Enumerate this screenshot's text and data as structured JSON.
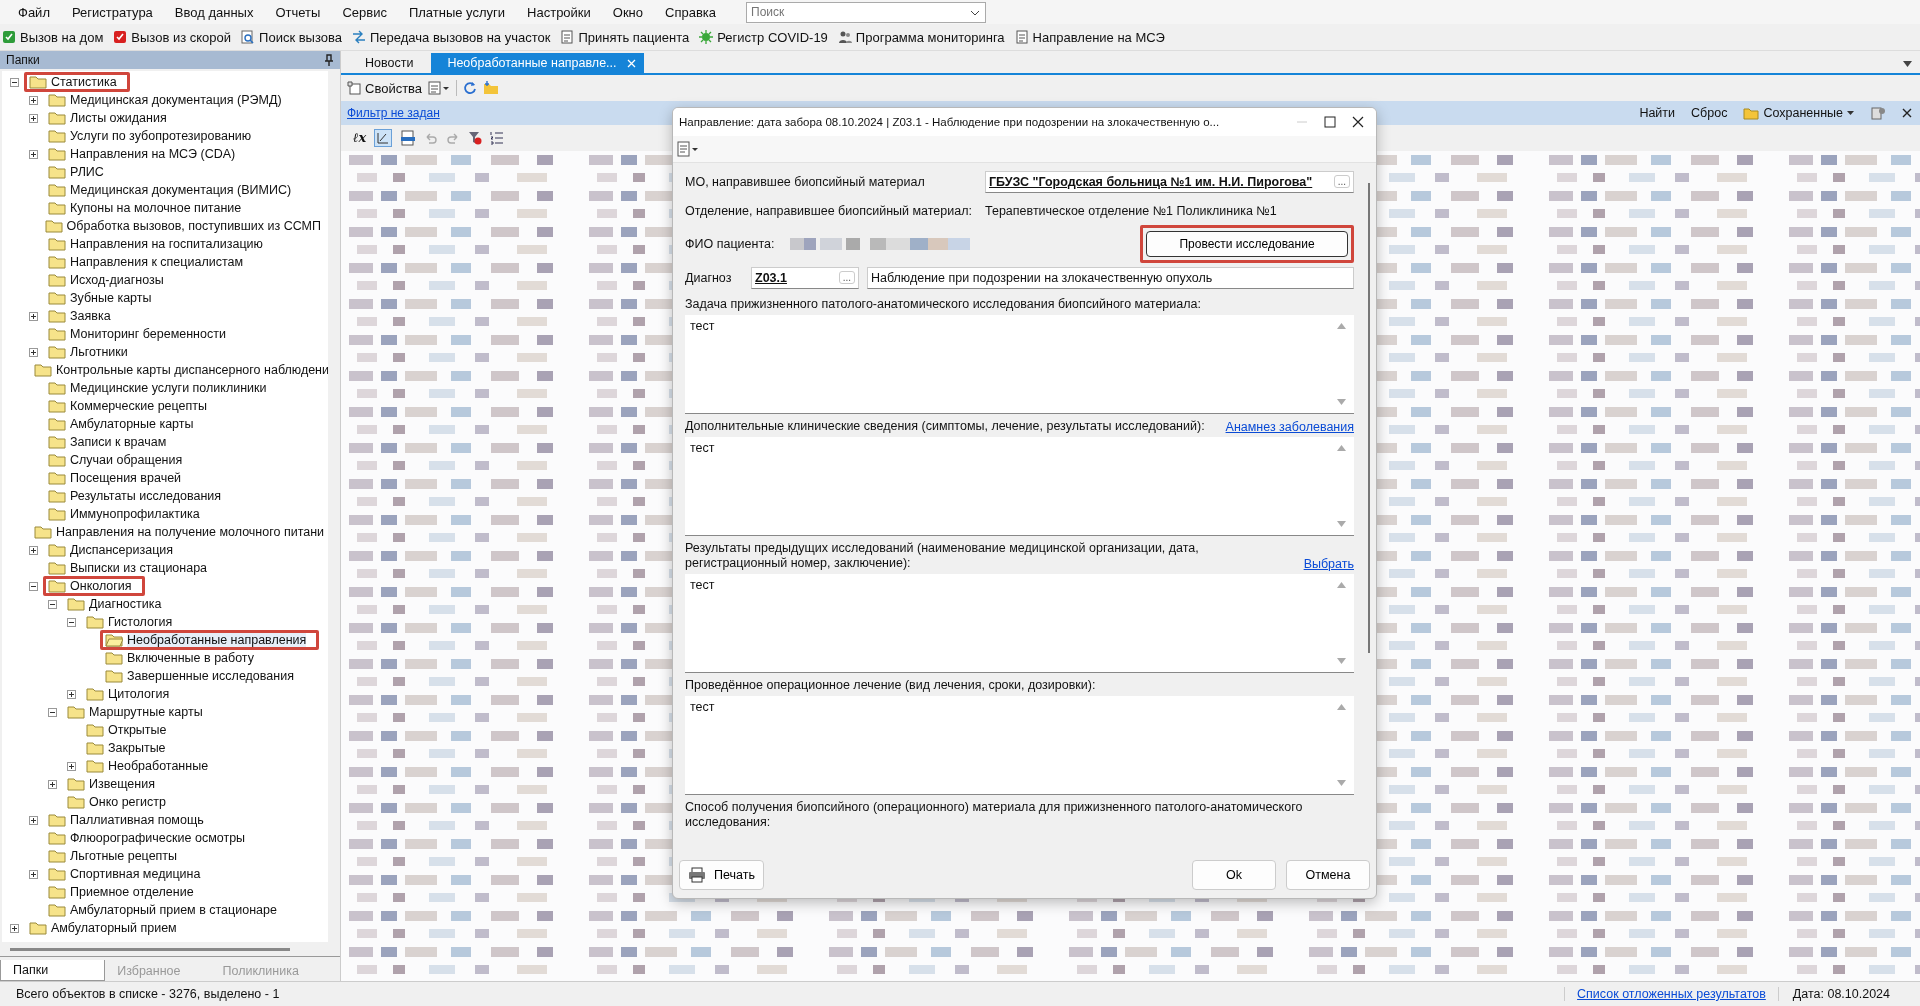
{
  "menu": [
    "Файл",
    "Регистратура",
    "Ввод данных",
    "Отчеты",
    "Сервис",
    "Платные услуги",
    "Настройки",
    "Окно",
    "Справка"
  ],
  "search": {
    "placeholder": "Поиск"
  },
  "toolbar": [
    "Вызов на дом",
    "Вызов из скорой",
    "Поиск вызова",
    "Передача вызовов на участок",
    "Принять пациента",
    "Регистр COVID-19",
    "Программа мониторинга",
    "Направление на МСЭ"
  ],
  "folders_panel": {
    "title": "Папки",
    "tree": [
      {
        "label": "Статистика",
        "expanded": true,
        "selected": false,
        "highlighted": true,
        "children": [
          {
            "label": "Медицинская документация (РЭМД)",
            "expanded": false,
            "selected": false,
            "highlighted": false
          },
          {
            "label": "Листы ожидания",
            "expanded": false,
            "selected": false,
            "highlighted": false
          },
          {
            "label": "Услуги по зубопротезированию",
            "selected": false,
            "highlighted": false
          },
          {
            "label": "Направления на МСЭ (CDA)",
            "expanded": false,
            "selected": false,
            "highlighted": false
          },
          {
            "label": "РЛИС",
            "selected": false,
            "highlighted": false
          },
          {
            "label": "Медицинская документация (ВИМИС)",
            "selected": false,
            "highlighted": false
          },
          {
            "label": "Купоны на молочное питание",
            "selected": false,
            "highlighted": false
          },
          {
            "label": "Обработка вызовов, поступивших из ССМП",
            "selected": false,
            "highlighted": false
          },
          {
            "label": "Направления на госпитализацию",
            "selected": false,
            "highlighted": false
          },
          {
            "label": "Направления к специалистам",
            "selected": false,
            "highlighted": false
          },
          {
            "label": "Исход-диагнозы",
            "selected": false,
            "highlighted": false
          },
          {
            "label": "Зубные карты",
            "selected": false,
            "highlighted": false
          },
          {
            "label": "Заявка",
            "expanded": false,
            "selected": false,
            "highlighted": false
          },
          {
            "label": "Мониторинг беременности",
            "selected": false,
            "highlighted": false
          },
          {
            "label": "Льготники",
            "expanded": false,
            "selected": false,
            "highlighted": false
          },
          {
            "label": "Контрольные карты диспансерного наблюдени",
            "selected": false,
            "highlighted": false
          },
          {
            "label": "Медицинские услуги поликлиники",
            "selected": false,
            "highlighted": false
          },
          {
            "label": "Коммерческие рецепты",
            "selected": false,
            "highlighted": false
          },
          {
            "label": "Амбулаторные карты",
            "selected": false,
            "highlighted": false
          },
          {
            "label": "Записи к врачам",
            "selected": false,
            "highlighted": false
          },
          {
            "label": "Случаи обращения",
            "selected": false,
            "highlighted": false
          },
          {
            "label": "Посещения врачей",
            "selected": false,
            "highlighted": false
          },
          {
            "label": "Результаты исследования",
            "selected": false,
            "highlighted": false
          },
          {
            "label": "Иммунопрофилактика",
            "selected": false,
            "highlighted": false
          },
          {
            "label": "Направления на получение молочного питани",
            "selected": false,
            "highlighted": false
          },
          {
            "label": "Диспансеризация",
            "expanded": false,
            "selected": false,
            "highlighted": false
          },
          {
            "label": "Выписки из стационара",
            "selected": false,
            "highlighted": false
          },
          {
            "label": "Онкология",
            "expanded": true,
            "selected": false,
            "highlighted": true,
            "children": [
              {
                "label": "Диагностика",
                "expanded": true,
                "selected": false,
                "highlighted": false,
                "children": [
                  {
                    "label": "Гистология",
                    "expanded": true,
                    "selected": false,
                    "highlighted": false,
                    "children": [
                      {
                        "label": "Необработанные направления",
                        "selected": true,
                        "highlighted": true
                      },
                      {
                        "label": "Включенные в работу",
                        "selected": false,
                        "highlighted": false
                      },
                      {
                        "label": "Завершенные исследования",
                        "selected": false,
                        "highlighted": false
                      }
                    ]
                  },
                  {
                    "label": "Цитология",
                    "expanded": false,
                    "selected": false,
                    "highlighted": false
                  }
                ]
              },
              {
                "label": "Маршрутные карты",
                "expanded": true,
                "selected": false,
                "highlighted": false,
                "children": [
                  {
                    "label": "Открытые",
                    "selected": false,
                    "highlighted": false
                  },
                  {
                    "label": "Закрытые",
                    "selected": false,
                    "highlighted": false
                  },
                  {
                    "label": "Необработанные",
                    "expanded": false,
                    "selected": false,
                    "highlighted": false
                  }
                ]
              },
              {
                "label": "Извещения",
                "expanded": false,
                "selected": false,
                "highlighted": false
              },
              {
                "label": "Онко регистр",
                "selected": false,
                "highlighted": false
              }
            ]
          },
          {
            "label": "Паллиативная помощь",
            "expanded": false,
            "selected": false,
            "highlighted": false
          },
          {
            "label": "Флюорографические осмотры",
            "selected": false,
            "highlighted": false
          },
          {
            "label": "Льготные рецепты",
            "selected": false,
            "highlighted": false
          },
          {
            "label": "Спортивная медицина",
            "expanded": false,
            "selected": false,
            "highlighted": false
          },
          {
            "label": "Приемное отделение",
            "selected": false,
            "highlighted": false
          },
          {
            "label": "Амбулаторный прием в стационаре",
            "selected": false,
            "highlighted": false
          }
        ]
      },
      {
        "label": "Амбулаторный прием",
        "expanded": false,
        "selected": false,
        "highlighted": false
      }
    ],
    "bottom_tabs": [
      {
        "label": "Папки",
        "selected": true
      },
      {
        "label": "Избранное",
        "selected": false
      },
      {
        "label": "Поликлиника",
        "selected": false
      }
    ]
  },
  "doc_tabs": [
    {
      "label": "Новости",
      "selected": false
    },
    {
      "label": "Необработанные направле...",
      "selected": true
    }
  ],
  "doc_toolbar": {
    "properties": "Свойства"
  },
  "filter_bar": {
    "filter_link": "Фильтр не задан",
    "find": "Найти",
    "reset": "Сброс",
    "saved": "Сохраненные"
  },
  "grid_toolbar": {
    "formula": "ℓx"
  },
  "dialog": {
    "title": "Направление: дата забора 08.10.2024 | Z03.1 - Наблюдение при подозрении на злокачественную о...",
    "mo": {
      "label": "МО, направившее биопсийный материал",
      "value": "ГБУЗС \"Городская больница №1 им. Н.И. Пирогова\"",
      "browse": "..."
    },
    "department": {
      "label": "Отделение, направившее биопсийный материал:",
      "value": "Терапевтическое отделение №1 Поликлиника №1"
    },
    "patient": {
      "label": "ФИО пациента:"
    },
    "action_button": {
      "label": "Провести исследование",
      "highlighted": true
    },
    "diagnosis": {
      "label": "Диагноз",
      "code": "Z03.1",
      "browse": "...",
      "description": "Наблюдение при подозрении на злокачественную опухоль"
    },
    "sections": [
      {
        "label": "Задача прижизненного патолого-анатомического исследования биопсийного материала:",
        "value": "тест"
      },
      {
        "label": "Дополнительные клинические сведения (симптомы, лечение, результаты исследований):",
        "value": "тест",
        "link": "Анамнез заболевания"
      },
      {
        "label": "Результаты предыдущих исследований (наименование медицинской организации, дата, регистрационный номер, заключение):",
        "value": "тест",
        "link": "Выбрать"
      },
      {
        "label": "Проведённое операционное лечение (вид лечения, сроки, дозировки):",
        "value": "тест"
      },
      {
        "label": "Способ получения биопсийного (операционного) материала для прижизненного патолого-анатомического исследования:"
      }
    ],
    "print": "Печать",
    "ok": "Ok",
    "cancel": "Отмена"
  },
  "status_bar": {
    "summary": "Всего объектов в списке - 3276, выделено - 1",
    "deferred_link": "Список отложенных результатов",
    "date": "Дата: 08.10.2024"
  }
}
